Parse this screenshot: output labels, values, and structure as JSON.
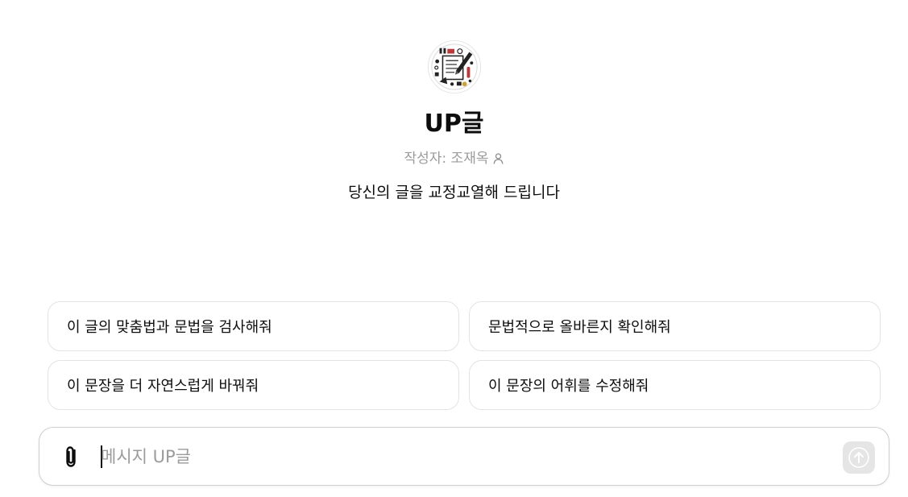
{
  "gpt": {
    "avatar_icon": "pencil-document-icon",
    "name": "UP글",
    "author": "작성자: 조재옥",
    "author_icon": "person-icon",
    "description": "당신의 글을 교정교열해 드립니다"
  },
  "suggestions": [
    {
      "label": "이 글의 맞춤법과 문법을 검사해줘"
    },
    {
      "label": "문법적으로 올바른지 확인해줘"
    },
    {
      "label": "이 문장을 더 자연스럽게 바꿔줘"
    },
    {
      "label": "이 문장의 어휘를 수정해줘"
    }
  ],
  "composer": {
    "attach_icon": "paperclip-icon",
    "placeholder": "메시지 UP글",
    "value": "",
    "send_icon": "arrow-up-icon",
    "send_enabled": false
  },
  "colors": {
    "text": "#0d0d0d",
    "muted": "#9b9b9b",
    "border": "#e3e3e3",
    "send_disabled_bg": "#e5e5e5"
  }
}
